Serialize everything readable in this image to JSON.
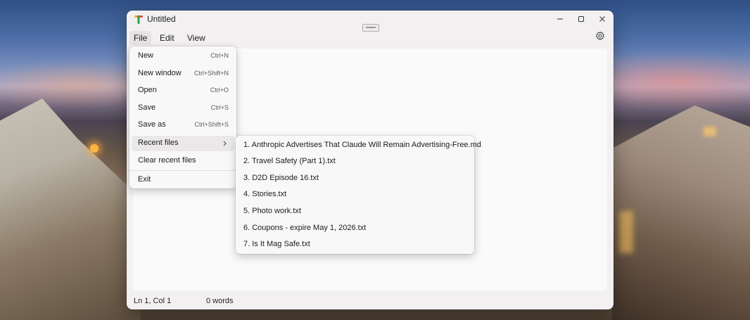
{
  "window": {
    "title": "Untitled"
  },
  "menubar": {
    "file": "File",
    "edit": "Edit",
    "view": "View"
  },
  "file_menu": {
    "items": [
      {
        "label": "New",
        "shortcut": "Ctrl+N"
      },
      {
        "label": "New window",
        "shortcut": "Ctrl+Shift+N"
      },
      {
        "label": "Open",
        "shortcut": "Ctrl+O"
      },
      {
        "label": "Save",
        "shortcut": "Ctrl+S"
      },
      {
        "label": "Save as",
        "shortcut": "Ctrl+Shift+S"
      },
      {
        "label": "Recent files",
        "shortcut": ""
      },
      {
        "label": "Clear recent files",
        "shortcut": ""
      },
      {
        "label": "Exit",
        "shortcut": ""
      }
    ]
  },
  "recent_files": [
    "1. Anthropic Advertises That Claude Will Remain Advertising-Free.md",
    "2. Travel Safety (Part 1).txt",
    "3. D2D Episode 16.txt",
    "4. Stories.txt",
    "5. Photo work.txt",
    "6. Coupons - expire May 1, 2026.txt",
    "7. Is It Mag Safe.txt"
  ],
  "statusbar": {
    "position": "Ln 1, Col 1",
    "words": "0 words"
  },
  "icons": {
    "app": "notepad-app-icon",
    "settings": "gear-icon",
    "submenu": "chevron-right-icon"
  }
}
